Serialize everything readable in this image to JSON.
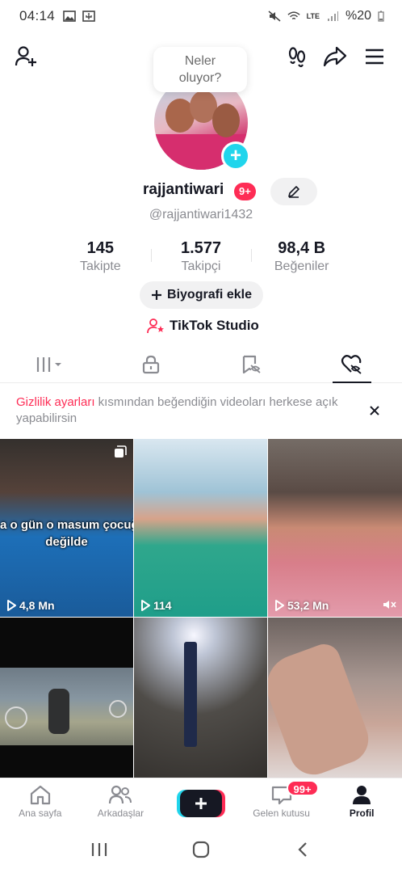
{
  "status_bar": {
    "time": "04:14",
    "battery": "%20",
    "network": "LTE"
  },
  "header": {
    "bubble_line1": "Neler",
    "bubble_line2": "oluyor?"
  },
  "profile": {
    "username": "rajjantiwari",
    "notification_badge": "9+",
    "handle": "@rajjantiwari1432",
    "avatar_ring_color": "#20d5ec"
  },
  "stats": [
    {
      "value": "145",
      "label": "Takipte"
    },
    {
      "value": "1.577",
      "label": "Takipçi"
    },
    {
      "value": "98,4 B",
      "label": "Beğeniler"
    }
  ],
  "actions": {
    "bio_label": "Biyografi ekle",
    "studio_label": "TikTok Studio"
  },
  "tabs": [
    {
      "icon": "grid-icon",
      "active": false
    },
    {
      "icon": "lock-icon",
      "active": false
    },
    {
      "icon": "bookmark-hidden-icon",
      "active": false
    },
    {
      "icon": "liked-hidden-icon",
      "active": true
    }
  ],
  "notice": {
    "link": "Gizlilik ayarları",
    "text": " kısmından beğendiğin videoları herkese açık yapabilirsin"
  },
  "videos": [
    {
      "views": "4,8 Mn",
      "overlay_line1": "a o gün o masum çocuğ",
      "overlay_line2": "değilde",
      "multi": true
    },
    {
      "views": "114"
    },
    {
      "views": "53,2 Mn",
      "muted": true
    },
    {
      "views": ""
    },
    {
      "views": ""
    },
    {
      "views": ""
    }
  ],
  "bottom_nav": {
    "home": "Ana sayfa",
    "friends": "Arkadaşlar",
    "inbox": "Gelen kutusu",
    "inbox_badge": "99+",
    "profile": "Profil"
  },
  "colors": {
    "accent": "#fe2c55",
    "cyan": "#20d5ec",
    "text": "#161823",
    "muted": "#8a8b91"
  }
}
